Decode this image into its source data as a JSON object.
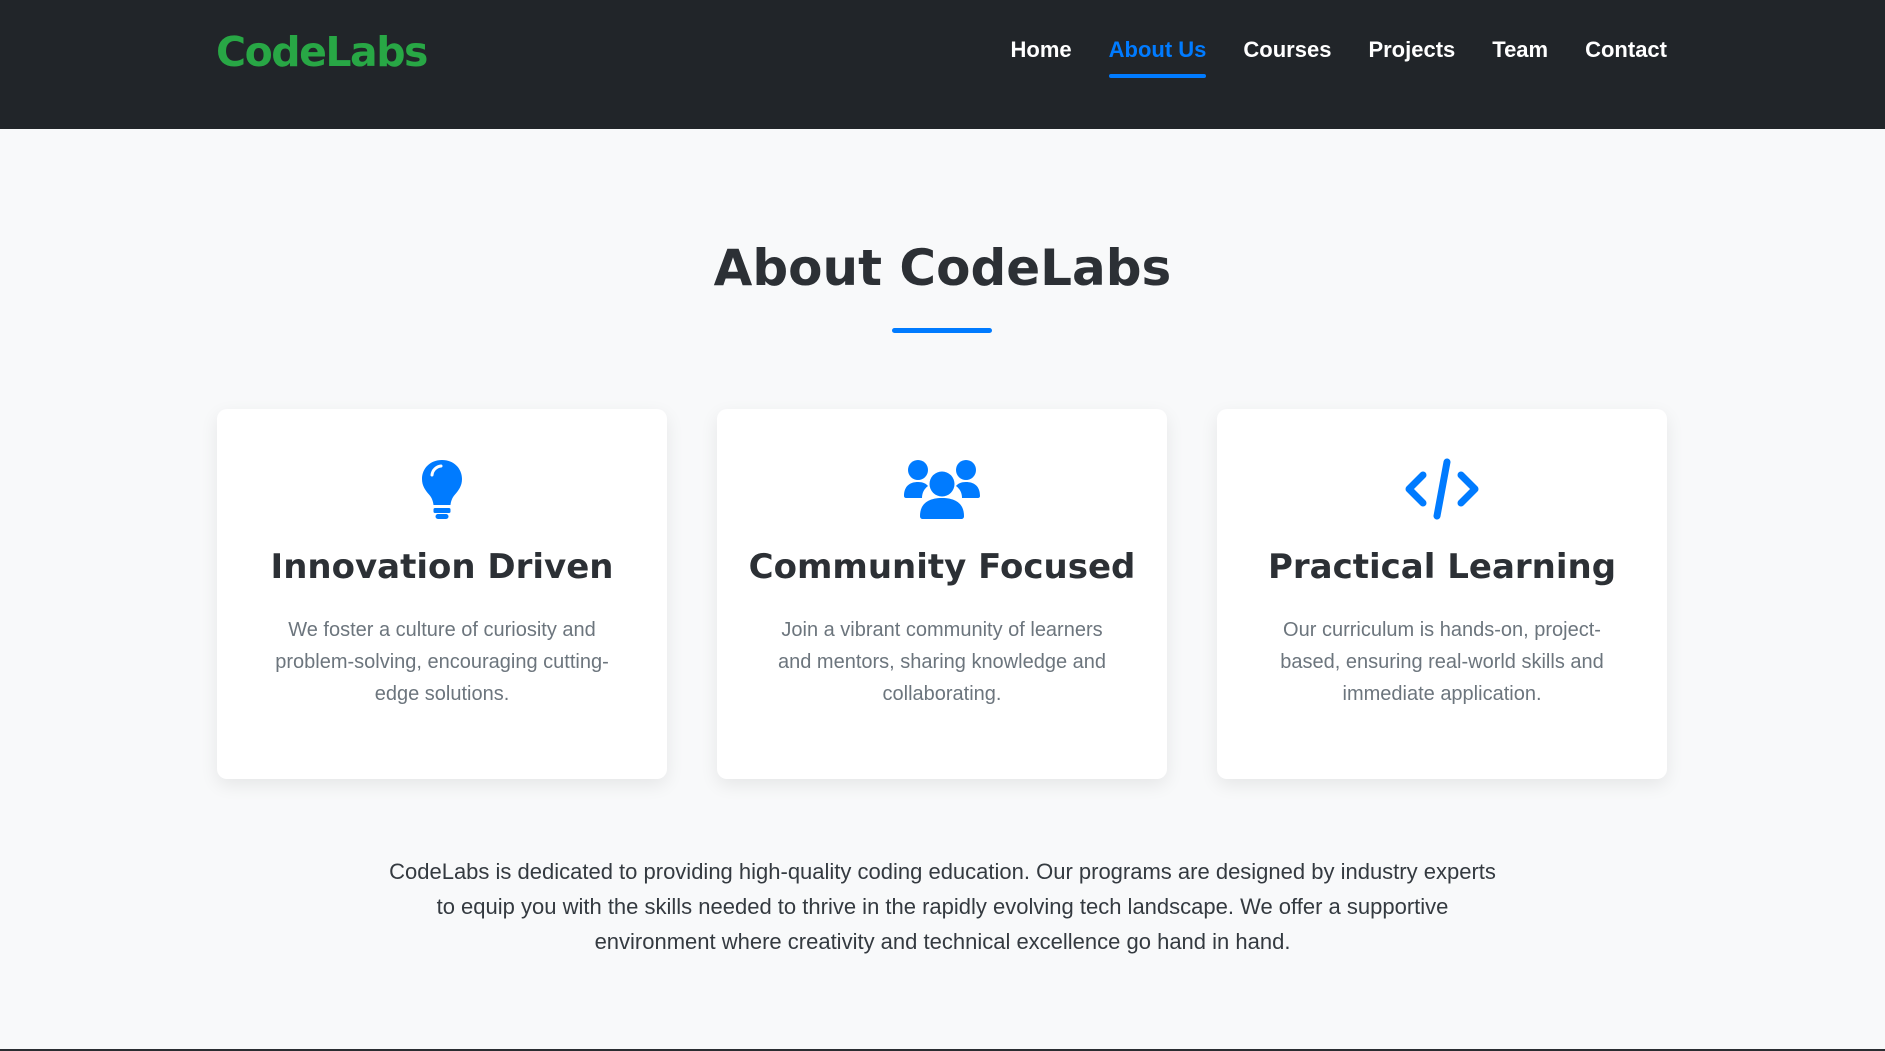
{
  "brand": {
    "logo_text": "CodeLabs",
    "logo_color": "#28a745"
  },
  "nav": {
    "items": [
      {
        "label": "Home",
        "active": false
      },
      {
        "label": "About Us",
        "active": true
      },
      {
        "label": "Courses",
        "active": false
      },
      {
        "label": "Projects",
        "active": false
      },
      {
        "label": "Team",
        "active": false
      },
      {
        "label": "Contact",
        "active": false
      }
    ]
  },
  "about": {
    "title": "About CodeLabs",
    "accent_color": "#007bff",
    "cards": [
      {
        "icon": "lightbulb-icon",
        "title": "Innovation Driven",
        "text": "We foster a culture of curiosity and problem-solving, encouraging cutting-edge solutions."
      },
      {
        "icon": "users-icon",
        "title": "Community Focused",
        "text": "Join a vibrant community of learners and mentors, sharing knowledge and collaborating."
      },
      {
        "icon": "code-icon",
        "title": "Practical Learning",
        "text": "Our curriculum is hands-on, project-based, ensuring real-world skills and immediate application."
      }
    ],
    "paragraph": "CodeLabs is dedicated to providing high-quality coding education. Our programs are designed by industry experts to equip you with the skills needed to thrive in the rapidly evolving tech landscape. We offer a supportive environment where creativity and technical excellence go hand in hand."
  }
}
